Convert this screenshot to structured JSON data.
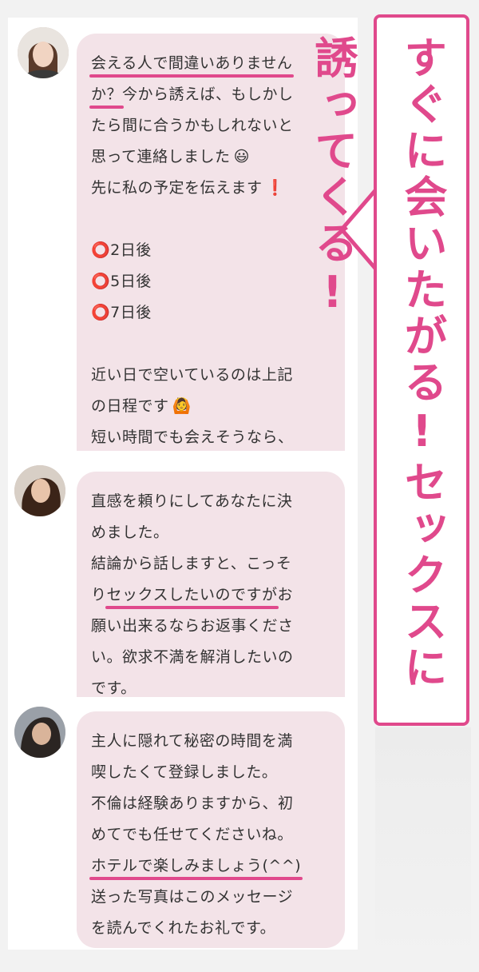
{
  "messages": [
    {
      "lines": [
        [
          "会える人で間違いありません"
        ],
        [
          "か？",
          "今から誘えば、もしかし"
        ],
        [
          "たら間に合うかもしれないと"
        ],
        [
          "思って連絡しました",
          "😃"
        ],
        [
          "先に私の予定を伝えます",
          "❗"
        ],
        [],
        [
          "⭕",
          "2日後"
        ],
        [
          "⭕",
          "5日後"
        ],
        [
          "⭕",
          "7日後"
        ],
        [],
        [
          "近い日で空いているのは上記"
        ],
        [
          "の日程です",
          "🙆"
        ],
        [
          "短い時間でも会えそうなら、"
        ]
      ]
    },
    {
      "lines": [
        [
          "直感を頼りにしてあなたに決"
        ],
        [
          "めました。"
        ],
        [
          "結論から話しますと、こっそ"
        ],
        [
          "り",
          "セックスしたいのですが",
          "お"
        ],
        [
          "願い出来るならお返事くださ"
        ],
        [
          "い。欲求不満を解消したいの"
        ],
        [
          "です。"
        ]
      ]
    },
    {
      "lines": [
        [
          "主人に隠れて秘密の時間を満"
        ],
        [
          "喫したくて登録しました。"
        ],
        [
          "不倫は経験ありますから、初"
        ],
        [
          "めてでも任せてくださいね。"
        ],
        [
          "ホテルで楽しみましょう(^^)"
        ],
        [
          "送った写真はこのメッセージ"
        ],
        [
          "を読んでくれたお礼です。"
        ]
      ]
    }
  ],
  "callout": {
    "text": "すぐに会いたがる!セックスに誘ってくる!"
  },
  "colors": {
    "accent": "#e0498c",
    "bubble": "#f3e3e8"
  }
}
